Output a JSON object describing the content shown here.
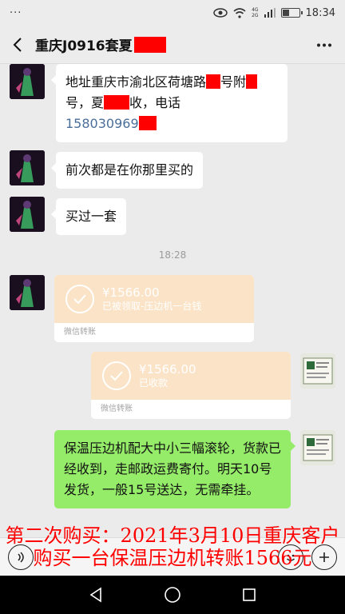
{
  "status_bar": {
    "left": "···",
    "net_top": "4G",
    "net_bottom": "2G",
    "time": "18:34"
  },
  "header": {
    "title": "重庆J0916套夏"
  },
  "messages": {
    "m1_line1": "地址重庆市渝北区荷塘路",
    "m1_line1b": "号附",
    "m1_line2a": "号，夏",
    "m1_line2b": "收，电话",
    "m1_phone": "158030969",
    "m2": "前次都是在你那里买的",
    "m3": "买过一套",
    "timestamp": "18:28",
    "t1_amount": "¥1566.00",
    "t1_status": "已被领取-压边机一台钱",
    "t1_footer": "微信转账",
    "t2_amount": "¥1566.00",
    "t2_status": "已收款",
    "t2_footer": "微信转账",
    "m4": "保温压边机配大中小三幅滚轮，货款已经收到，走邮政运费寄付。明天10号发货，一般15号送达，无需牵挂。"
  },
  "caption": {
    "line1": "第二次购买：2021年3月10日重庆客户",
    "line2": "购买一台保温压边机转账1566元"
  },
  "colors": {
    "accent_green": "#95ec69",
    "transfer_orange": "#fbe3c7",
    "redact_red": "#ff0000",
    "caption_red": "#ff0000"
  },
  "icons": {
    "back": "chevron-left-icon",
    "more": "more-dots-icon",
    "voice": "voice-icon",
    "emoji": "emoji-icon",
    "plus": "plus-icon"
  }
}
